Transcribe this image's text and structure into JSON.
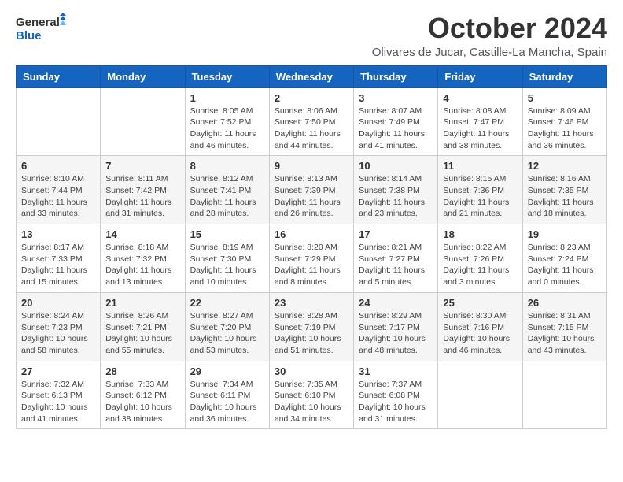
{
  "header": {
    "logo_line1": "General",
    "logo_line2": "Blue",
    "title": "October 2024",
    "subtitle": "Olivares de Jucar, Castille-La Mancha, Spain"
  },
  "days_of_week": [
    "Sunday",
    "Monday",
    "Tuesday",
    "Wednesday",
    "Thursday",
    "Friday",
    "Saturday"
  ],
  "weeks": [
    [
      {
        "day": "",
        "info": ""
      },
      {
        "day": "",
        "info": ""
      },
      {
        "day": "1",
        "info": "Sunrise: 8:05 AM\nSunset: 7:52 PM\nDaylight: 11 hours and 46 minutes."
      },
      {
        "day": "2",
        "info": "Sunrise: 8:06 AM\nSunset: 7:50 PM\nDaylight: 11 hours and 44 minutes."
      },
      {
        "day": "3",
        "info": "Sunrise: 8:07 AM\nSunset: 7:49 PM\nDaylight: 11 hours and 41 minutes."
      },
      {
        "day": "4",
        "info": "Sunrise: 8:08 AM\nSunset: 7:47 PM\nDaylight: 11 hours and 38 minutes."
      },
      {
        "day": "5",
        "info": "Sunrise: 8:09 AM\nSunset: 7:46 PM\nDaylight: 11 hours and 36 minutes."
      }
    ],
    [
      {
        "day": "6",
        "info": "Sunrise: 8:10 AM\nSunset: 7:44 PM\nDaylight: 11 hours and 33 minutes."
      },
      {
        "day": "7",
        "info": "Sunrise: 8:11 AM\nSunset: 7:42 PM\nDaylight: 11 hours and 31 minutes."
      },
      {
        "day": "8",
        "info": "Sunrise: 8:12 AM\nSunset: 7:41 PM\nDaylight: 11 hours and 28 minutes."
      },
      {
        "day": "9",
        "info": "Sunrise: 8:13 AM\nSunset: 7:39 PM\nDaylight: 11 hours and 26 minutes."
      },
      {
        "day": "10",
        "info": "Sunrise: 8:14 AM\nSunset: 7:38 PM\nDaylight: 11 hours and 23 minutes."
      },
      {
        "day": "11",
        "info": "Sunrise: 8:15 AM\nSunset: 7:36 PM\nDaylight: 11 hours and 21 minutes."
      },
      {
        "day": "12",
        "info": "Sunrise: 8:16 AM\nSunset: 7:35 PM\nDaylight: 11 hours and 18 minutes."
      }
    ],
    [
      {
        "day": "13",
        "info": "Sunrise: 8:17 AM\nSunset: 7:33 PM\nDaylight: 11 hours and 15 minutes."
      },
      {
        "day": "14",
        "info": "Sunrise: 8:18 AM\nSunset: 7:32 PM\nDaylight: 11 hours and 13 minutes."
      },
      {
        "day": "15",
        "info": "Sunrise: 8:19 AM\nSunset: 7:30 PM\nDaylight: 11 hours and 10 minutes."
      },
      {
        "day": "16",
        "info": "Sunrise: 8:20 AM\nSunset: 7:29 PM\nDaylight: 11 hours and 8 minutes."
      },
      {
        "day": "17",
        "info": "Sunrise: 8:21 AM\nSunset: 7:27 PM\nDaylight: 11 hours and 5 minutes."
      },
      {
        "day": "18",
        "info": "Sunrise: 8:22 AM\nSunset: 7:26 PM\nDaylight: 11 hours and 3 minutes."
      },
      {
        "day": "19",
        "info": "Sunrise: 8:23 AM\nSunset: 7:24 PM\nDaylight: 11 hours and 0 minutes."
      }
    ],
    [
      {
        "day": "20",
        "info": "Sunrise: 8:24 AM\nSunset: 7:23 PM\nDaylight: 10 hours and 58 minutes."
      },
      {
        "day": "21",
        "info": "Sunrise: 8:26 AM\nSunset: 7:21 PM\nDaylight: 10 hours and 55 minutes."
      },
      {
        "day": "22",
        "info": "Sunrise: 8:27 AM\nSunset: 7:20 PM\nDaylight: 10 hours and 53 minutes."
      },
      {
        "day": "23",
        "info": "Sunrise: 8:28 AM\nSunset: 7:19 PM\nDaylight: 10 hours and 51 minutes."
      },
      {
        "day": "24",
        "info": "Sunrise: 8:29 AM\nSunset: 7:17 PM\nDaylight: 10 hours and 48 minutes."
      },
      {
        "day": "25",
        "info": "Sunrise: 8:30 AM\nSunset: 7:16 PM\nDaylight: 10 hours and 46 minutes."
      },
      {
        "day": "26",
        "info": "Sunrise: 8:31 AM\nSunset: 7:15 PM\nDaylight: 10 hours and 43 minutes."
      }
    ],
    [
      {
        "day": "27",
        "info": "Sunrise: 7:32 AM\nSunset: 6:13 PM\nDaylight: 10 hours and 41 minutes."
      },
      {
        "day": "28",
        "info": "Sunrise: 7:33 AM\nSunset: 6:12 PM\nDaylight: 10 hours and 38 minutes."
      },
      {
        "day": "29",
        "info": "Sunrise: 7:34 AM\nSunset: 6:11 PM\nDaylight: 10 hours and 36 minutes."
      },
      {
        "day": "30",
        "info": "Sunrise: 7:35 AM\nSunset: 6:10 PM\nDaylight: 10 hours and 34 minutes."
      },
      {
        "day": "31",
        "info": "Sunrise: 7:37 AM\nSunset: 6:08 PM\nDaylight: 10 hours and 31 minutes."
      },
      {
        "day": "",
        "info": ""
      },
      {
        "day": "",
        "info": ""
      }
    ]
  ]
}
